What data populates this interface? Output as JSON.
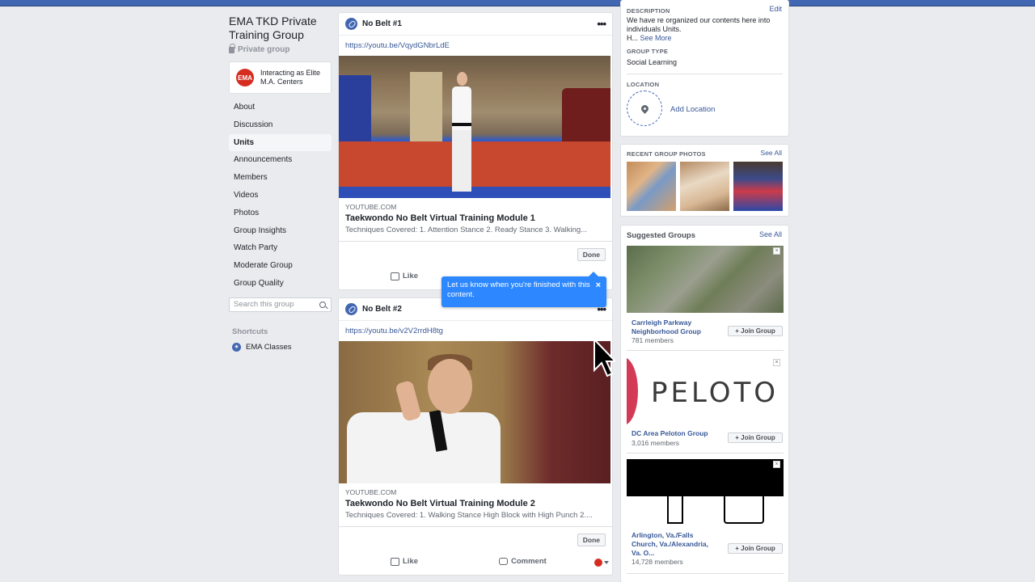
{
  "group": {
    "title": "EMA TKD Private Training Group",
    "privacy": "Private group",
    "interacting_as": "Interacting as Elite M.A. Centers",
    "logo_text": "EMA"
  },
  "nav": {
    "items": [
      {
        "label": "About"
      },
      {
        "label": "Discussion"
      },
      {
        "label": "Units"
      },
      {
        "label": "Announcements"
      },
      {
        "label": "Members"
      },
      {
        "label": "Videos"
      },
      {
        "label": "Photos"
      },
      {
        "label": "Group Insights"
      },
      {
        "label": "Watch Party"
      },
      {
        "label": "Moderate Group"
      },
      {
        "label": "Group Quality"
      }
    ],
    "active": "Units",
    "search_placeholder": "Search this group",
    "shortcuts_heading": "Shortcuts",
    "shortcut_label": "EMA Classes"
  },
  "posts": [
    {
      "title": "No Belt #1",
      "url": "https://youtu.be/VqydGNbrLdE",
      "domain": "YOUTUBE.COM",
      "link_title": "Taekwondo No Belt Virtual Training Module 1",
      "link_desc": "Techniques Covered: 1. Attention Stance 2. Ready Stance 3. Walking...",
      "done_label": "Done",
      "like_label": "Like"
    },
    {
      "title": "No Belt #2",
      "url": "https://youtu.be/v2V2rrdH8tg",
      "domain": "YOUTUBE.COM",
      "link_title": "Taekwondo No Belt Virtual Training Module 2",
      "link_desc": "Techniques Covered: 1. Walking Stance High Block with High Punch 2....",
      "done_label": "Done",
      "like_label": "Like",
      "comment_label": "Comment"
    }
  ],
  "tooltip": {
    "text": "Let us know when you're finished with this content.",
    "close": "×"
  },
  "about": {
    "description_label": "DESCRIPTION",
    "edit_label": "Edit",
    "description_text": "We have re organized our contents here into individuals Units.",
    "description_more_prefix": "H...",
    "see_more": "See More",
    "group_type_label": "GROUP TYPE",
    "group_type": "Social Learning",
    "location_label": "LOCATION",
    "add_location": "Add Location"
  },
  "recent_photos": {
    "label": "RECENT GROUP PHOTOS",
    "see_all": "See All"
  },
  "suggested": {
    "label": "Suggested Groups",
    "see_all": "See All",
    "groups": [
      {
        "name": "Carrleigh Parkway Neighborhood Group",
        "members": "781 members",
        "join": "+ Join Group"
      },
      {
        "name": "DC Area Peloton Group",
        "members": "3,016 members",
        "join": "+ Join Group",
        "image_text": "PELOTO"
      },
      {
        "name": "Arlington, Va./Falls Church, Va./Alexandria, Va. O...",
        "members": "14,728 members",
        "join": "+ Join Group"
      }
    ]
  },
  "colors": {
    "brand": "#4267b2",
    "link": "#385898",
    "tooltip": "#2d88ff",
    "background": "#e9ebee"
  }
}
